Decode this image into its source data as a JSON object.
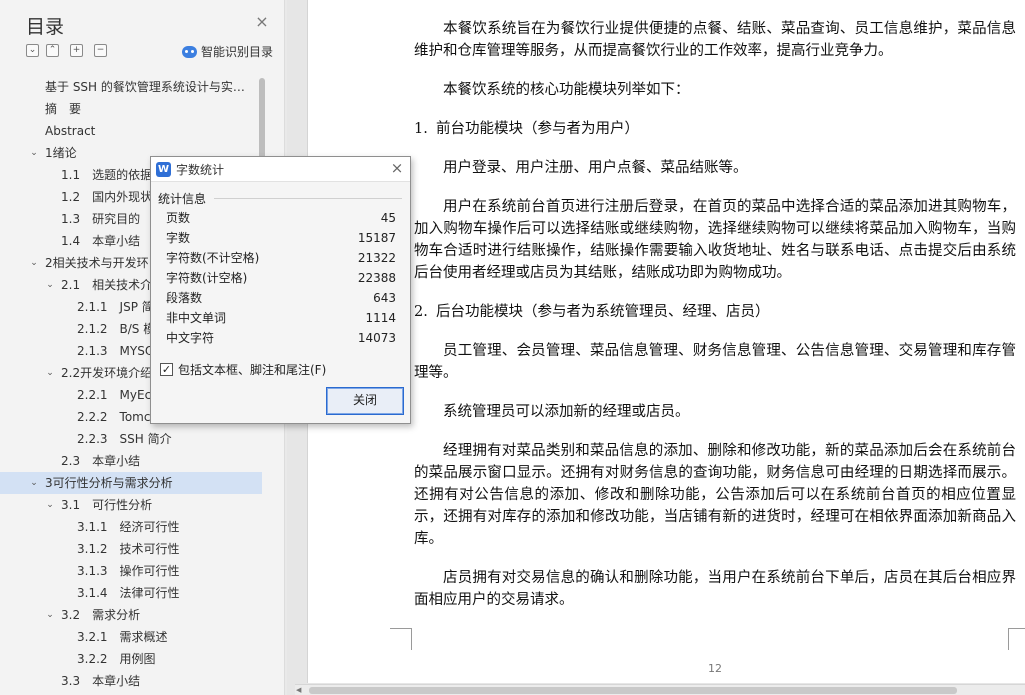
{
  "toc": {
    "title": "目录",
    "smart_label": "智能识别目录",
    "toolbar_icons": [
      "collapse-all-icon",
      "expand-level-icon",
      "add-icon",
      "remove-icon"
    ],
    "toolbar_glyphs": [
      "⌄",
      "⌃",
      "+",
      "−"
    ],
    "items": [
      {
        "label": "基于 SSH 的餐饮管理系统设计与实…",
        "level": 0,
        "chevron": ""
      },
      {
        "label": "摘　要",
        "level": 0,
        "chevron": ""
      },
      {
        "label": "Abstract",
        "level": 0,
        "chevron": ""
      },
      {
        "label": "1绪论",
        "level": 0,
        "chevron": "⌄"
      },
      {
        "label": "1.1　选题的依据",
        "level": 1,
        "chevron": ""
      },
      {
        "label": "1.2　国内外现状",
        "level": 1,
        "chevron": ""
      },
      {
        "label": "1.3　研究目的",
        "level": 1,
        "chevron": ""
      },
      {
        "label": "1.4　本章小结",
        "level": 1,
        "chevron": ""
      },
      {
        "label": "2相关技术与开发环",
        "level": 0,
        "chevron": "⌄"
      },
      {
        "label": "2.1　相关技术介",
        "level": 1,
        "chevron": "⌄"
      },
      {
        "label": "2.1.1　JSP 简",
        "level": 2,
        "chevron": ""
      },
      {
        "label": "2.1.2　B/S 模",
        "level": 2,
        "chevron": ""
      },
      {
        "label": "2.1.3　MYSQ",
        "level": 2,
        "chevron": ""
      },
      {
        "label": "2.2开发环境介绍",
        "level": 1,
        "chevron": "⌄"
      },
      {
        "label": "2.2.1　MyEcl",
        "level": 2,
        "chevron": ""
      },
      {
        "label": "2.2.2　Tomca",
        "level": 2,
        "chevron": ""
      },
      {
        "label": "2.2.3　SSH 简介",
        "level": 2,
        "chevron": ""
      },
      {
        "label": "2.3　本章小结",
        "level": 1,
        "chevron": ""
      },
      {
        "label": "3可行性分析与需求分析",
        "level": 0,
        "chevron": "⌄",
        "selected": true
      },
      {
        "label": "3.1　可行性分析",
        "level": 1,
        "chevron": "⌄"
      },
      {
        "label": "3.1.1　经济可行性",
        "level": 2,
        "chevron": ""
      },
      {
        "label": "3.1.2　技术可行性",
        "level": 2,
        "chevron": ""
      },
      {
        "label": "3.1.3　操作可行性",
        "level": 2,
        "chevron": ""
      },
      {
        "label": "3.1.4　法律可行性",
        "level": 2,
        "chevron": ""
      },
      {
        "label": "3.2　需求分析",
        "level": 1,
        "chevron": "⌄"
      },
      {
        "label": "3.2.1　需求概述",
        "level": 2,
        "chevron": ""
      },
      {
        "label": "3.2.2　用例图",
        "level": 2,
        "chevron": ""
      },
      {
        "label": "3.3　本章小结",
        "level": 1,
        "chevron": ""
      }
    ]
  },
  "document": {
    "blocks": [
      {
        "type": "para",
        "text": "本餐饮系统旨在为餐饮行业提供便捷的点餐、结账、菜品查询、员工信息维护，菜品信息维护和仓库管理等服务，从而提高餐饮行业的工作效率，提高行业竞争力。"
      },
      {
        "type": "para",
        "text": "本餐饮系统的核心功能模块列举如下："
      },
      {
        "type": "list",
        "num": "1.",
        "text": "前台功能模块（参与者为用户）"
      },
      {
        "type": "para",
        "text": "用户登录、用户注册、用户点餐、菜品结账等。"
      },
      {
        "type": "para",
        "text": "用户在系统前台首页进行注册后登录，在首页的菜品中选择合适的菜品添加进其购物车，加入购物车操作后可以选择结账或继续购物，选择继续购物可以继续将菜品加入购物车，当购物车合适时进行结账操作，结账操作需要输入收货地址、姓名与联系电话、点击提交后由系统后台使用者经理或店员为其结账，结账成功即为购物成功。"
      },
      {
        "type": "list",
        "num": "2.",
        "text": "后台功能模块（参与者为系统管理员、经理、店员）"
      },
      {
        "type": "para",
        "text": "员工管理、会员管理、菜品信息管理、财务信息管理、公告信息管理、交易管理和库存管理等。"
      },
      {
        "type": "para",
        "text": "系统管理员可以添加新的经理或店员。"
      },
      {
        "type": "para",
        "text": "经理拥有对菜品类别和菜品信息的添加、删除和修改功能，新的菜品添加后会在系统前台的菜品展示窗口显示。还拥有对财务信息的查询功能，财务信息可由经理的日期选择而展示。还拥有对公告信息的添加、修改和删除功能，公告添加后可以在系统前台首页的相应位置显示，还拥有对库存的添加和修改功能，当店铺有新的进货时，经理可在相依界面添加新商品入库。"
      },
      {
        "type": "para",
        "text": "店员拥有对交易信息的确认和删除功能，当用户在系统前台下单后，店员在其后台相应界面相应用户的交易请求。"
      }
    ],
    "page_number": "12"
  },
  "dialog": {
    "icon_glyph": "W",
    "title": "字数统计",
    "close_glyph": "×",
    "group_title": "统计信息",
    "stats": [
      {
        "label": "页数",
        "value": "45"
      },
      {
        "label": "字数",
        "value": "15187"
      },
      {
        "label": "字符数(不计空格)",
        "value": "21322"
      },
      {
        "label": "字符数(计空格)",
        "value": "22388"
      },
      {
        "label": "段落数",
        "value": "643"
      },
      {
        "label": "非中文单词",
        "value": "1114"
      },
      {
        "label": "中文字符",
        "value": "14073"
      }
    ],
    "checkbox_label": "包括文本框、脚注和尾注(F)",
    "checkbox_checked": true,
    "close_button": "关闭"
  },
  "colors": {
    "accent": "#2f6fd6",
    "selection": "#d3e1f4"
  }
}
